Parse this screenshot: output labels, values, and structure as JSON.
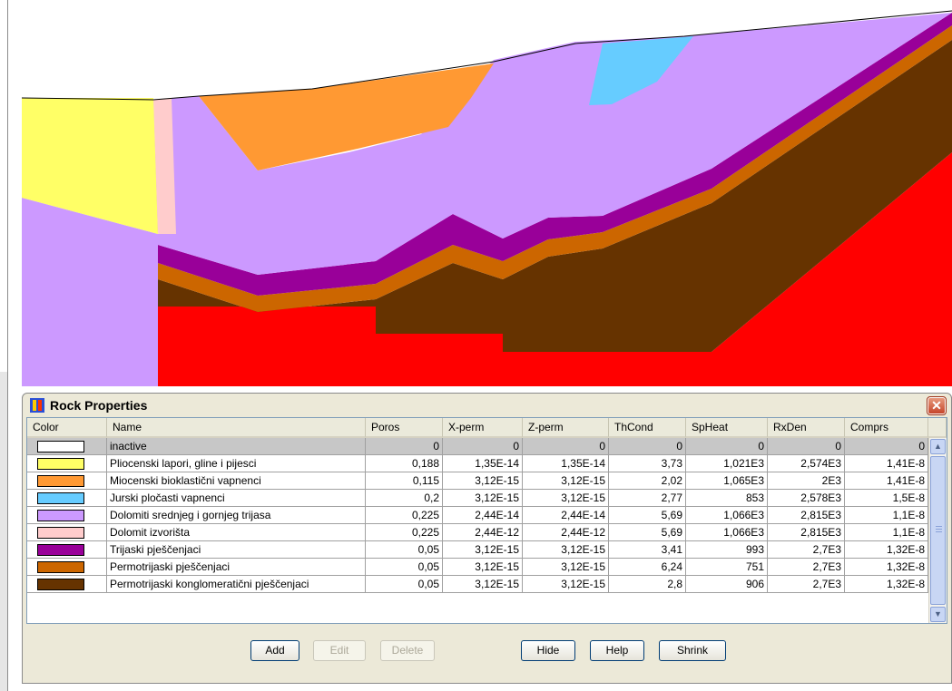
{
  "dialog": {
    "title": "Rock Properties",
    "close_glyph": "✕"
  },
  "table": {
    "columns": [
      "Color",
      "Name",
      "Poros",
      "X-perm",
      "Z-perm",
      "ThCond",
      "SpHeat",
      "RxDen",
      "Comprs"
    ],
    "rows": [
      {
        "color": "#ffffff",
        "name": "inactive",
        "poros": "0",
        "xperm": "0",
        "zperm": "0",
        "thcond": "0",
        "spheat": "0",
        "rxden": "0",
        "comprs": "0",
        "selected": true
      },
      {
        "color": "#ffff66",
        "name": "Pliocenski lapori, gline i pijesci",
        "poros": "0,188",
        "xperm": "1,35E-14",
        "zperm": "1,35E-14",
        "thcond": "3,73",
        "spheat": "1,021E3",
        "rxden": "2,574E3",
        "comprs": "1,41E-8"
      },
      {
        "color": "#ff9933",
        "name": "Miocenski bioklastični vapnenci",
        "poros": "0,115",
        "xperm": "3,12E-15",
        "zperm": "3,12E-15",
        "thcond": "2,02",
        "spheat": "1,065E3",
        "rxden": "2E3",
        "comprs": "1,41E-8"
      },
      {
        "color": "#66ccff",
        "name": "Jurski pločasti vapnenci",
        "poros": "0,2",
        "xperm": "3,12E-15",
        "zperm": "3,12E-15",
        "thcond": "2,77",
        "spheat": "853",
        "rxden": "2,578E3",
        "comprs": "1,5E-8"
      },
      {
        "color": "#cc99ff",
        "name": "Dolomiti srednjeg i gornjeg trijasa",
        "poros": "0,225",
        "xperm": "2,44E-14",
        "zperm": "2,44E-14",
        "thcond": "5,69",
        "spheat": "1,066E3",
        "rxden": "2,815E3",
        "comprs": "1,1E-8"
      },
      {
        "color": "#ffcccc",
        "name": "Dolomit izvorišta",
        "poros": "0,225",
        "xperm": "2,44E-12",
        "zperm": "2,44E-12",
        "thcond": "5,69",
        "spheat": "1,066E3",
        "rxden": "2,815E3",
        "comprs": "1,1E-8"
      },
      {
        "color": "#990099",
        "name": "Trijaski pješčenjaci",
        "poros": "0,05",
        "xperm": "3,12E-15",
        "zperm": "3,12E-15",
        "thcond": "3,41",
        "spheat": "993",
        "rxden": "2,7E3",
        "comprs": "1,32E-8"
      },
      {
        "color": "#cc6600",
        "name": "Permotrijaski pješčenjaci",
        "poros": "0,05",
        "xperm": "3,12E-15",
        "zperm": "3,12E-15",
        "thcond": "6,24",
        "spheat": "751",
        "rxden": "2,7E3",
        "comprs": "1,32E-8"
      },
      {
        "color": "#663300",
        "name": "Permotrijaski konglomeratični pješčenjaci",
        "poros": "0,05",
        "xperm": "3,12E-15",
        "zperm": "3,12E-15",
        "thcond": "2,8",
        "spheat": "906",
        "rxden": "2,7E3",
        "comprs": "1,32E-8"
      }
    ]
  },
  "scrollbar": {
    "up_glyph": "▲",
    "down_glyph": "▼"
  },
  "buttons": {
    "add": "Add",
    "edit": "Edit",
    "delete": "Delete",
    "hide": "Hide",
    "help": "Help",
    "shrink": "Shrink"
  },
  "colors": {
    "background_red": "#ff0000",
    "dialog_bg": "#ece9d8"
  }
}
